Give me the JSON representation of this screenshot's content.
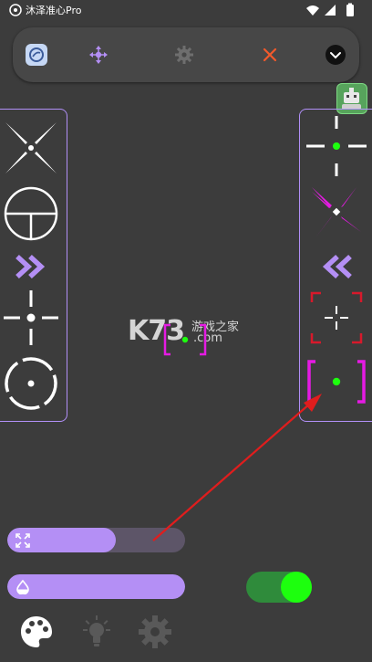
{
  "status_bar": {
    "app_title": "沐泽准心Pro"
  },
  "toolbar": {
    "buttons": [
      "crosshair-logo",
      "move",
      "settings",
      "close",
      "collapse"
    ],
    "colors": {
      "accent": "#b48ff5",
      "close": "#f2592b"
    }
  },
  "panels": {
    "left_styles": [
      "x-crosshair",
      "scope-crosshair",
      "chevrons-right",
      "dot-cross",
      "circle-dot"
    ],
    "right_styles": [
      "green-dot-cross",
      "magenta-x",
      "chevrons-left",
      "red-bracket-cross",
      "magenta-bracket-dot"
    ]
  },
  "watermark": {
    "brand": "K73",
    "site_cn": "游戏之家",
    "site_com": ".com"
  },
  "sliders": {
    "size_level": 0.61,
    "opacity_level": 1.0
  },
  "toggle": {
    "enabled": true
  },
  "colors": {
    "accent": "#b18ff7",
    "green": "#1dff0e",
    "magenta": "#e51be3",
    "red": "#d7192b"
  }
}
